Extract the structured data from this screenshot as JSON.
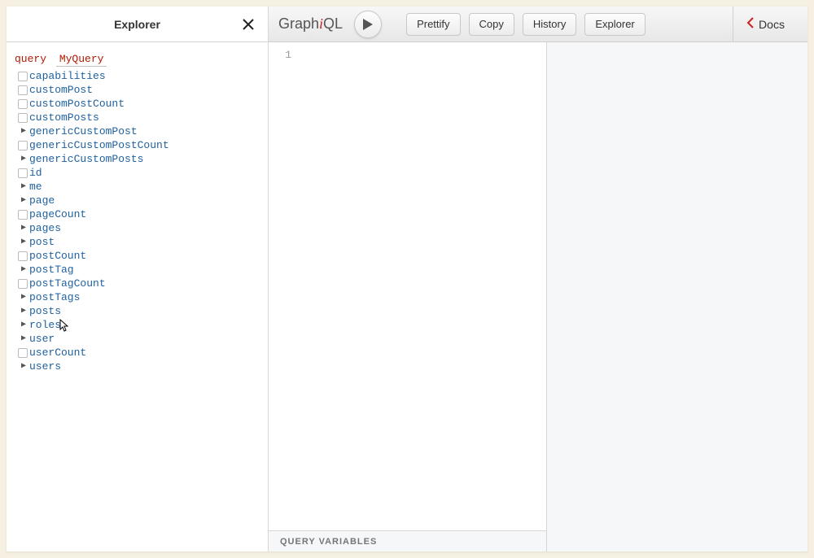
{
  "explorer": {
    "title": "Explorer",
    "query_keyword": "query",
    "query_name": "MyQuery",
    "fields": [
      {
        "label": "capabilities",
        "kind": "leaf"
      },
      {
        "label": "customPost",
        "kind": "leaf"
      },
      {
        "label": "customPostCount",
        "kind": "leaf"
      },
      {
        "label": "customPosts",
        "kind": "leaf"
      },
      {
        "label": "genericCustomPost",
        "kind": "branch"
      },
      {
        "label": "genericCustomPostCount",
        "kind": "leaf"
      },
      {
        "label": "genericCustomPosts",
        "kind": "branch"
      },
      {
        "label": "id",
        "kind": "leaf"
      },
      {
        "label": "me",
        "kind": "branch"
      },
      {
        "label": "page",
        "kind": "branch"
      },
      {
        "label": "pageCount",
        "kind": "leaf"
      },
      {
        "label": "pages",
        "kind": "branch"
      },
      {
        "label": "post",
        "kind": "branch"
      },
      {
        "label": "postCount",
        "kind": "leaf"
      },
      {
        "label": "postTag",
        "kind": "branch"
      },
      {
        "label": "postTagCount",
        "kind": "leaf"
      },
      {
        "label": "postTags",
        "kind": "branch"
      },
      {
        "label": "posts",
        "kind": "branch"
      },
      {
        "label": "roles",
        "kind": "branch"
      },
      {
        "label": "user",
        "kind": "branch"
      },
      {
        "label": "userCount",
        "kind": "leaf"
      },
      {
        "label": "users",
        "kind": "branch"
      }
    ]
  },
  "topbar": {
    "logo_pre": "Graph",
    "logo_mid": "i",
    "logo_post": "QL",
    "buttons": {
      "prettify": "Prettify",
      "copy": "Copy",
      "history": "History",
      "explorer": "Explorer"
    },
    "docs_label": "Docs"
  },
  "editor": {
    "gutter_start": "1",
    "code": "",
    "variables_label": "Query Variables"
  }
}
